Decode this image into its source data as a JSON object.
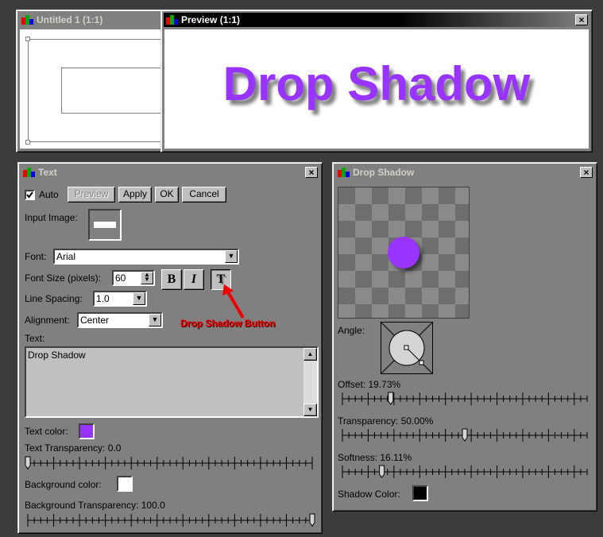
{
  "windows": {
    "untitled": {
      "title": "Untitled 1 (1:1)"
    },
    "preview": {
      "title": "Preview (1:1)",
      "close": "×",
      "banner_text": "Drop Shadow",
      "text_color": "#9933ff"
    },
    "text": {
      "title": "Text",
      "close": "×",
      "auto_label": "Auto",
      "preview_button": "Preview",
      "apply_button": "Apply",
      "ok_button": "OK",
      "cancel_button": "Cancel",
      "input_image_label": "Input Image:",
      "font_label": "Font:",
      "font_value": "Arial",
      "font_size_label": "Font Size (pixels):",
      "font_size_value": "60",
      "bold_label": "B",
      "italic_label": "I",
      "shadow_label": "T",
      "line_spacing_label": "Line Spacing:",
      "line_spacing_value": "1.0",
      "alignment_label": "Alignment:",
      "alignment_value": "Center",
      "text_label": "Text:",
      "text_value": "Drop Shadow",
      "text_color_label": "Text color:",
      "text_color": "#9933ff",
      "text_transparency_label": "Text Transparency: 0.0",
      "text_transparency_fraction": 0.0,
      "background_color_label": "Background color:",
      "background_color": "#ffffff",
      "background_transparency_label": "Background Transparency: 100.0",
      "background_transparency_fraction": 1.0
    },
    "drop_shadow": {
      "title": "Drop Shadow",
      "close": "×",
      "angle_label": "Angle:",
      "offset_label": "Offset: 19.73%",
      "offset_fraction": 0.1973,
      "transparency_label": "Transparency: 50.00%",
      "transparency_fraction": 0.5,
      "softness_label": "Softness: 16.11%",
      "softness_fraction": 0.1611,
      "shadow_color_label": "Shadow Color:",
      "shadow_color": "#000000",
      "ball_color": "#9933ff"
    }
  },
  "annotation": {
    "label": "Drop Shadow Button",
    "color": "#ee0000"
  },
  "icons": {
    "app": "app-icon",
    "close": "close-icon",
    "arrow": "arrow-icon"
  }
}
